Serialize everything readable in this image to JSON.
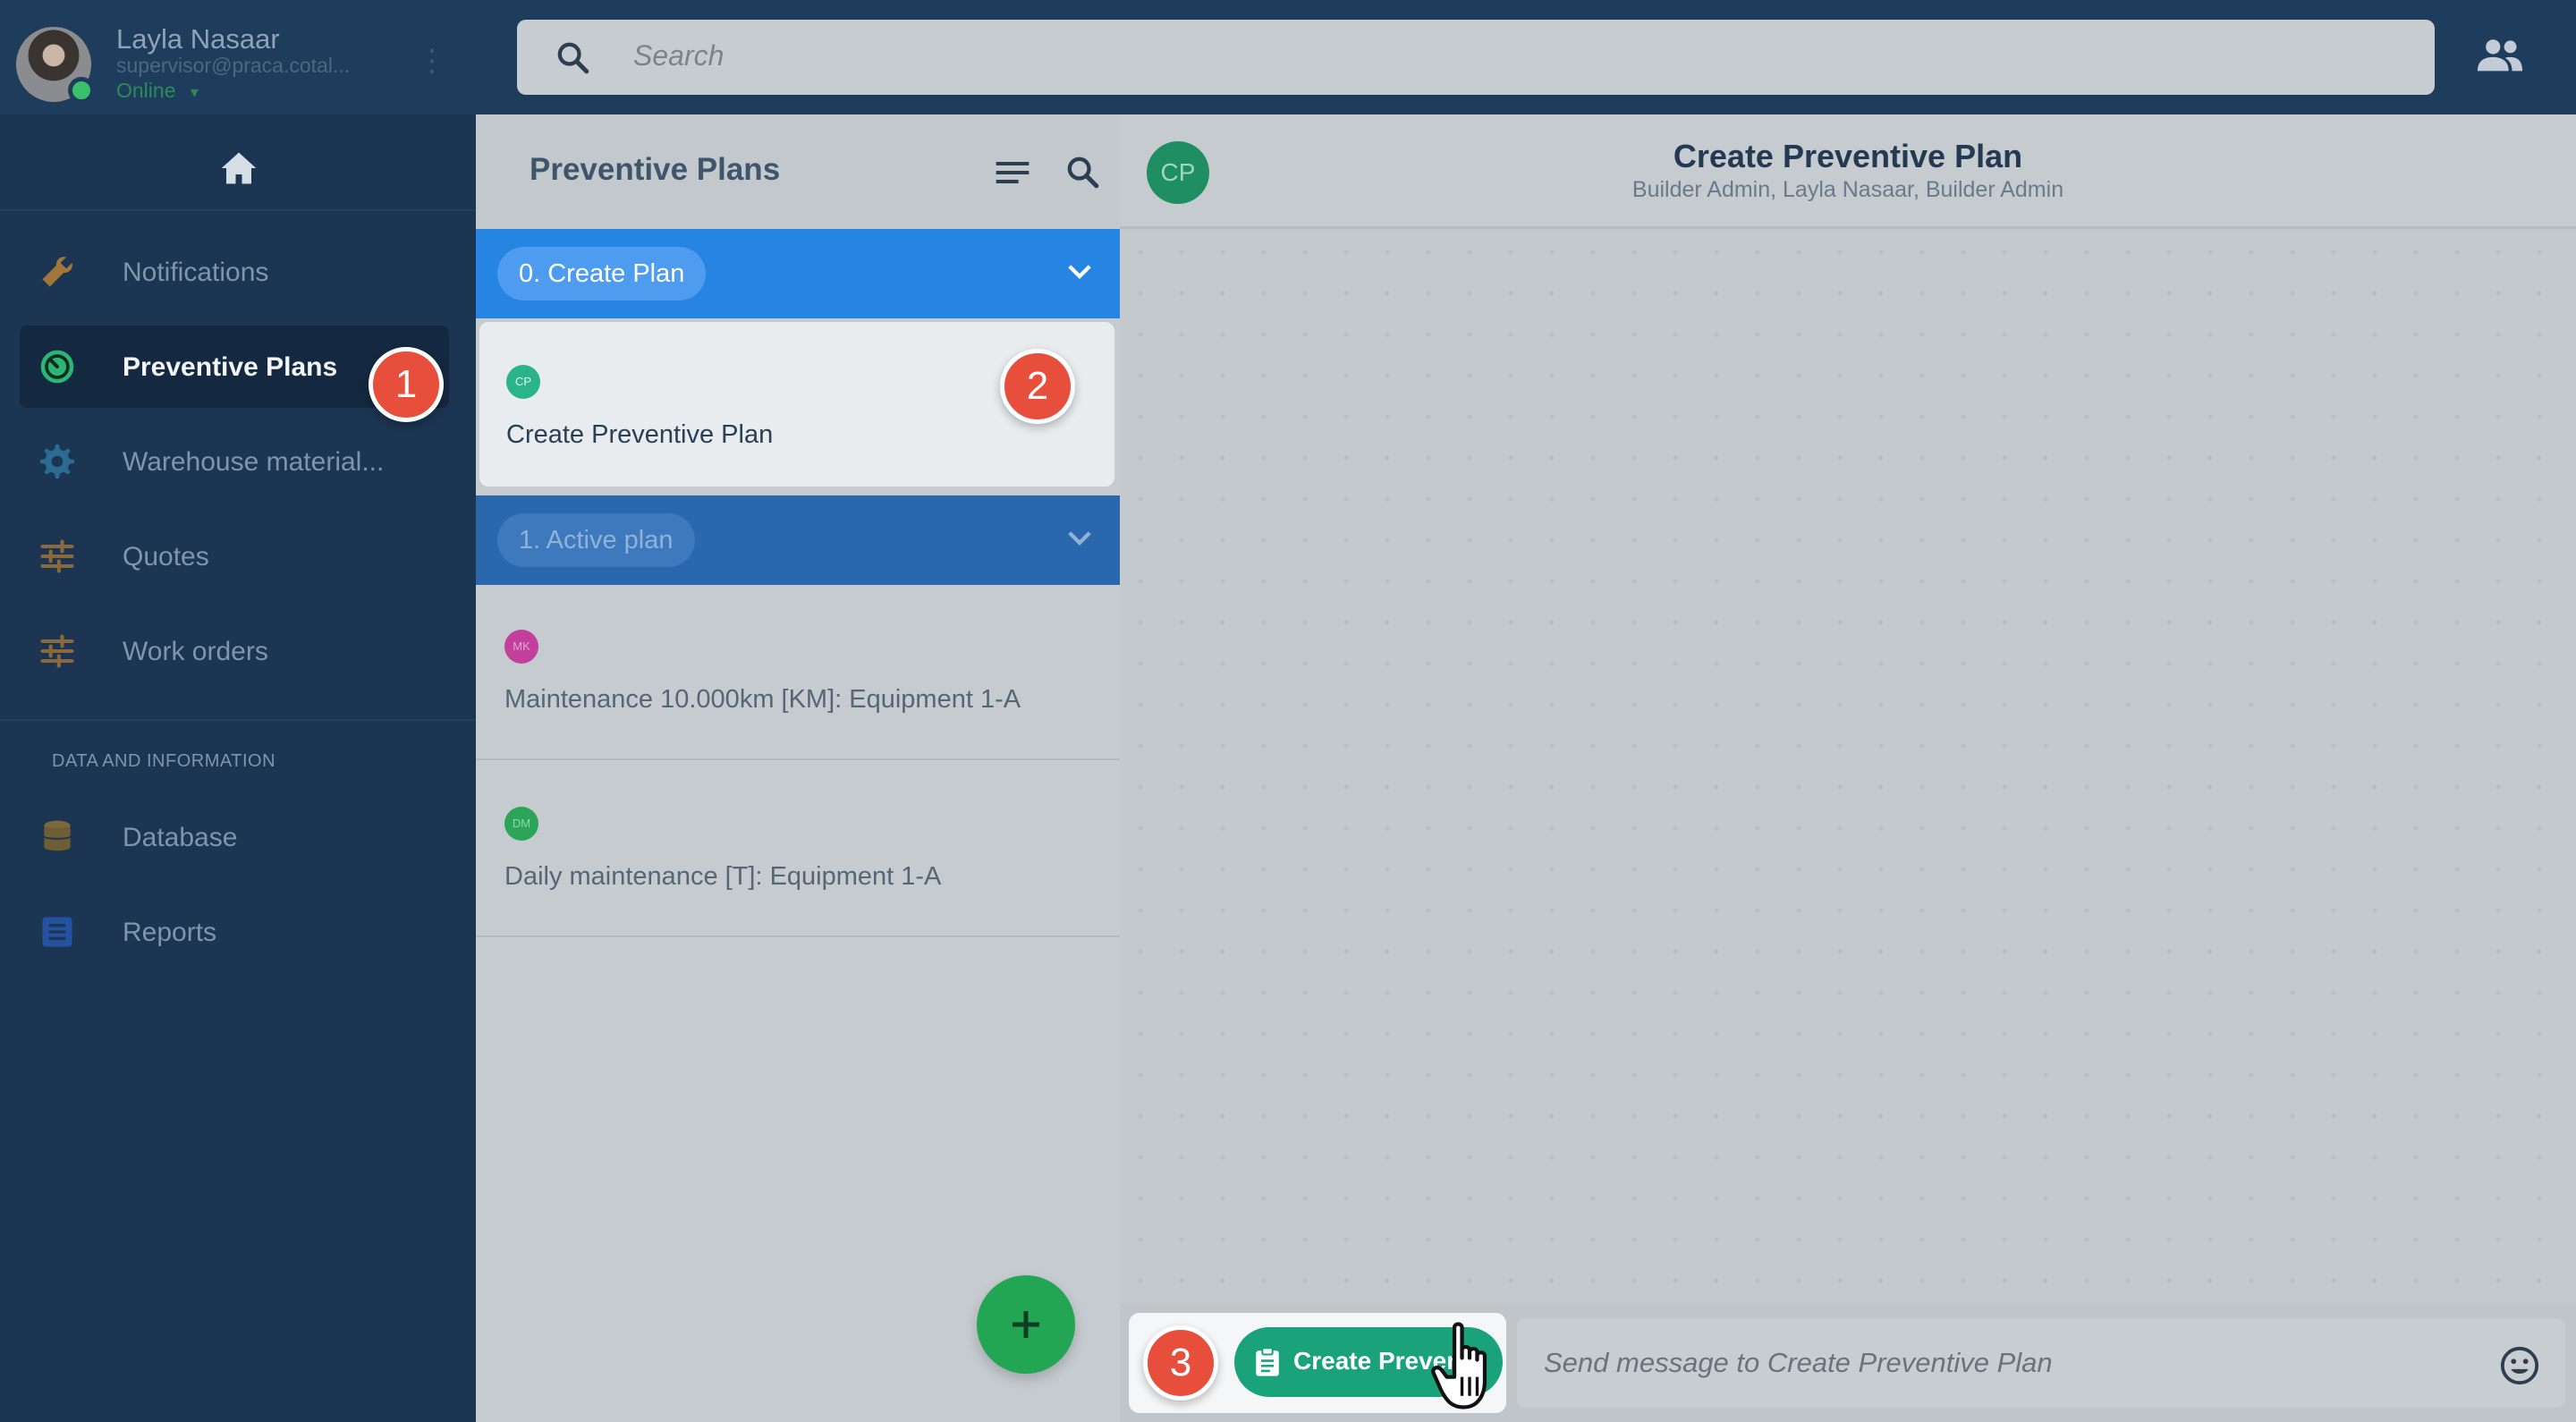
{
  "user": {
    "name": "Layla Nasaar",
    "email": "supervisor@praca.cotal...",
    "status": "Online",
    "status_caret": "▾",
    "more": "⋮"
  },
  "search": {
    "placeholder": "Search"
  },
  "sidebar": {
    "items": [
      {
        "label": "Notifications",
        "icon": "wrench-icon"
      },
      {
        "label": "Preventive Plans",
        "icon": "timer-icon",
        "active": true
      },
      {
        "label": "Warehouse material...",
        "icon": "gear-icon"
      },
      {
        "label": "Quotes",
        "icon": "sliders-icon"
      },
      {
        "label": "Work orders",
        "icon": "sliders-icon"
      }
    ],
    "section_label": "DATA AND INFORMATION",
    "section_items": [
      {
        "label": "Database",
        "icon": "database-icon"
      },
      {
        "label": "Reports",
        "icon": "list-icon"
      }
    ]
  },
  "list": {
    "title": "Preventive Plans",
    "groups": [
      {
        "label": "0. Create Plan",
        "items": [
          {
            "initials": "CP",
            "title": "Create Preventive Plan",
            "color": "#29b48a"
          }
        ]
      },
      {
        "label": "1. Active plan",
        "items": [
          {
            "initials": "MK",
            "title": "Maintenance 10.000km [KM]: Equipment 1-A",
            "color": "#c23f9c"
          },
          {
            "initials": "DM",
            "title": "Daily maintenance [T]: Equipment 1-A",
            "color": "#2aa55a"
          }
        ]
      }
    ],
    "fab_label": "+"
  },
  "chat": {
    "avatar_initials": "CP",
    "title": "Create Preventive Plan",
    "subtitle": "Builder Admin, Layla Nasaar, Builder Admin",
    "action_button_label": "Create Preven",
    "message_placeholder": "Send message to Create Preventive Plan"
  },
  "steps": [
    "1",
    "2",
    "3"
  ],
  "colors": {
    "accent_blue": "#2684e3",
    "fab_green": "#23a653",
    "action_green": "#1aa27a",
    "badge_red": "#e84e3c"
  }
}
